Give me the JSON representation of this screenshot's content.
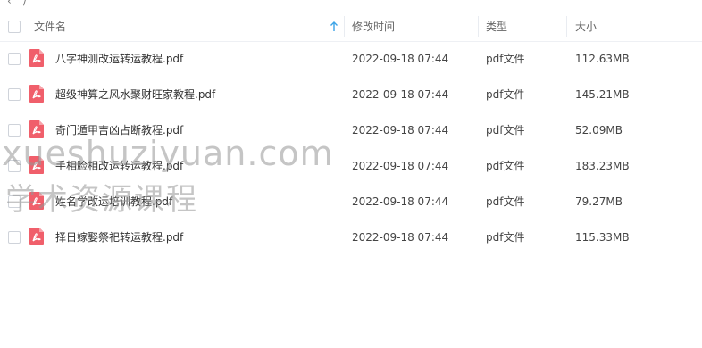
{
  "breadcrumb": {
    "back_glyph": "‹",
    "sep_glyph": "/"
  },
  "table": {
    "columns": {
      "name": "文件名",
      "modified": "修改时间",
      "type": "类型",
      "size": "大小"
    },
    "sort_icon": "arrow-up-icon",
    "rows": [
      {
        "name": "八字神测改运转运教程.pdf",
        "modified": "2022-09-18 07:44",
        "type": "pdf文件",
        "size": "112.63MB"
      },
      {
        "name": "超级神算之风水聚财旺家教程.pdf",
        "modified": "2022-09-18 07:44",
        "type": "pdf文件",
        "size": "145.21MB"
      },
      {
        "name": "奇门遁甲吉凶占断教程.pdf",
        "modified": "2022-09-18 07:44",
        "type": "pdf文件",
        "size": "52.09MB"
      },
      {
        "name": "手相脸相改运转运教程.pdf",
        "modified": "2022-09-18 07:44",
        "type": "pdf文件",
        "size": "183.23MB"
      },
      {
        "name": "姓名学改运培训教程.pdf",
        "modified": "2022-09-18 07:44",
        "type": "pdf文件",
        "size": "79.27MB"
      },
      {
        "name": "择日嫁娶祭祀转运教程.pdf",
        "modified": "2022-09-18 07:44",
        "type": "pdf文件",
        "size": "115.33MB"
      }
    ]
  },
  "watermark": {
    "line1": "xueshuziyuan.com",
    "line2": "学术资源课程"
  },
  "colors": {
    "pdf_red": "#f05f6b",
    "sort_blue": "#3ba3e6",
    "header_text": "#666666"
  }
}
